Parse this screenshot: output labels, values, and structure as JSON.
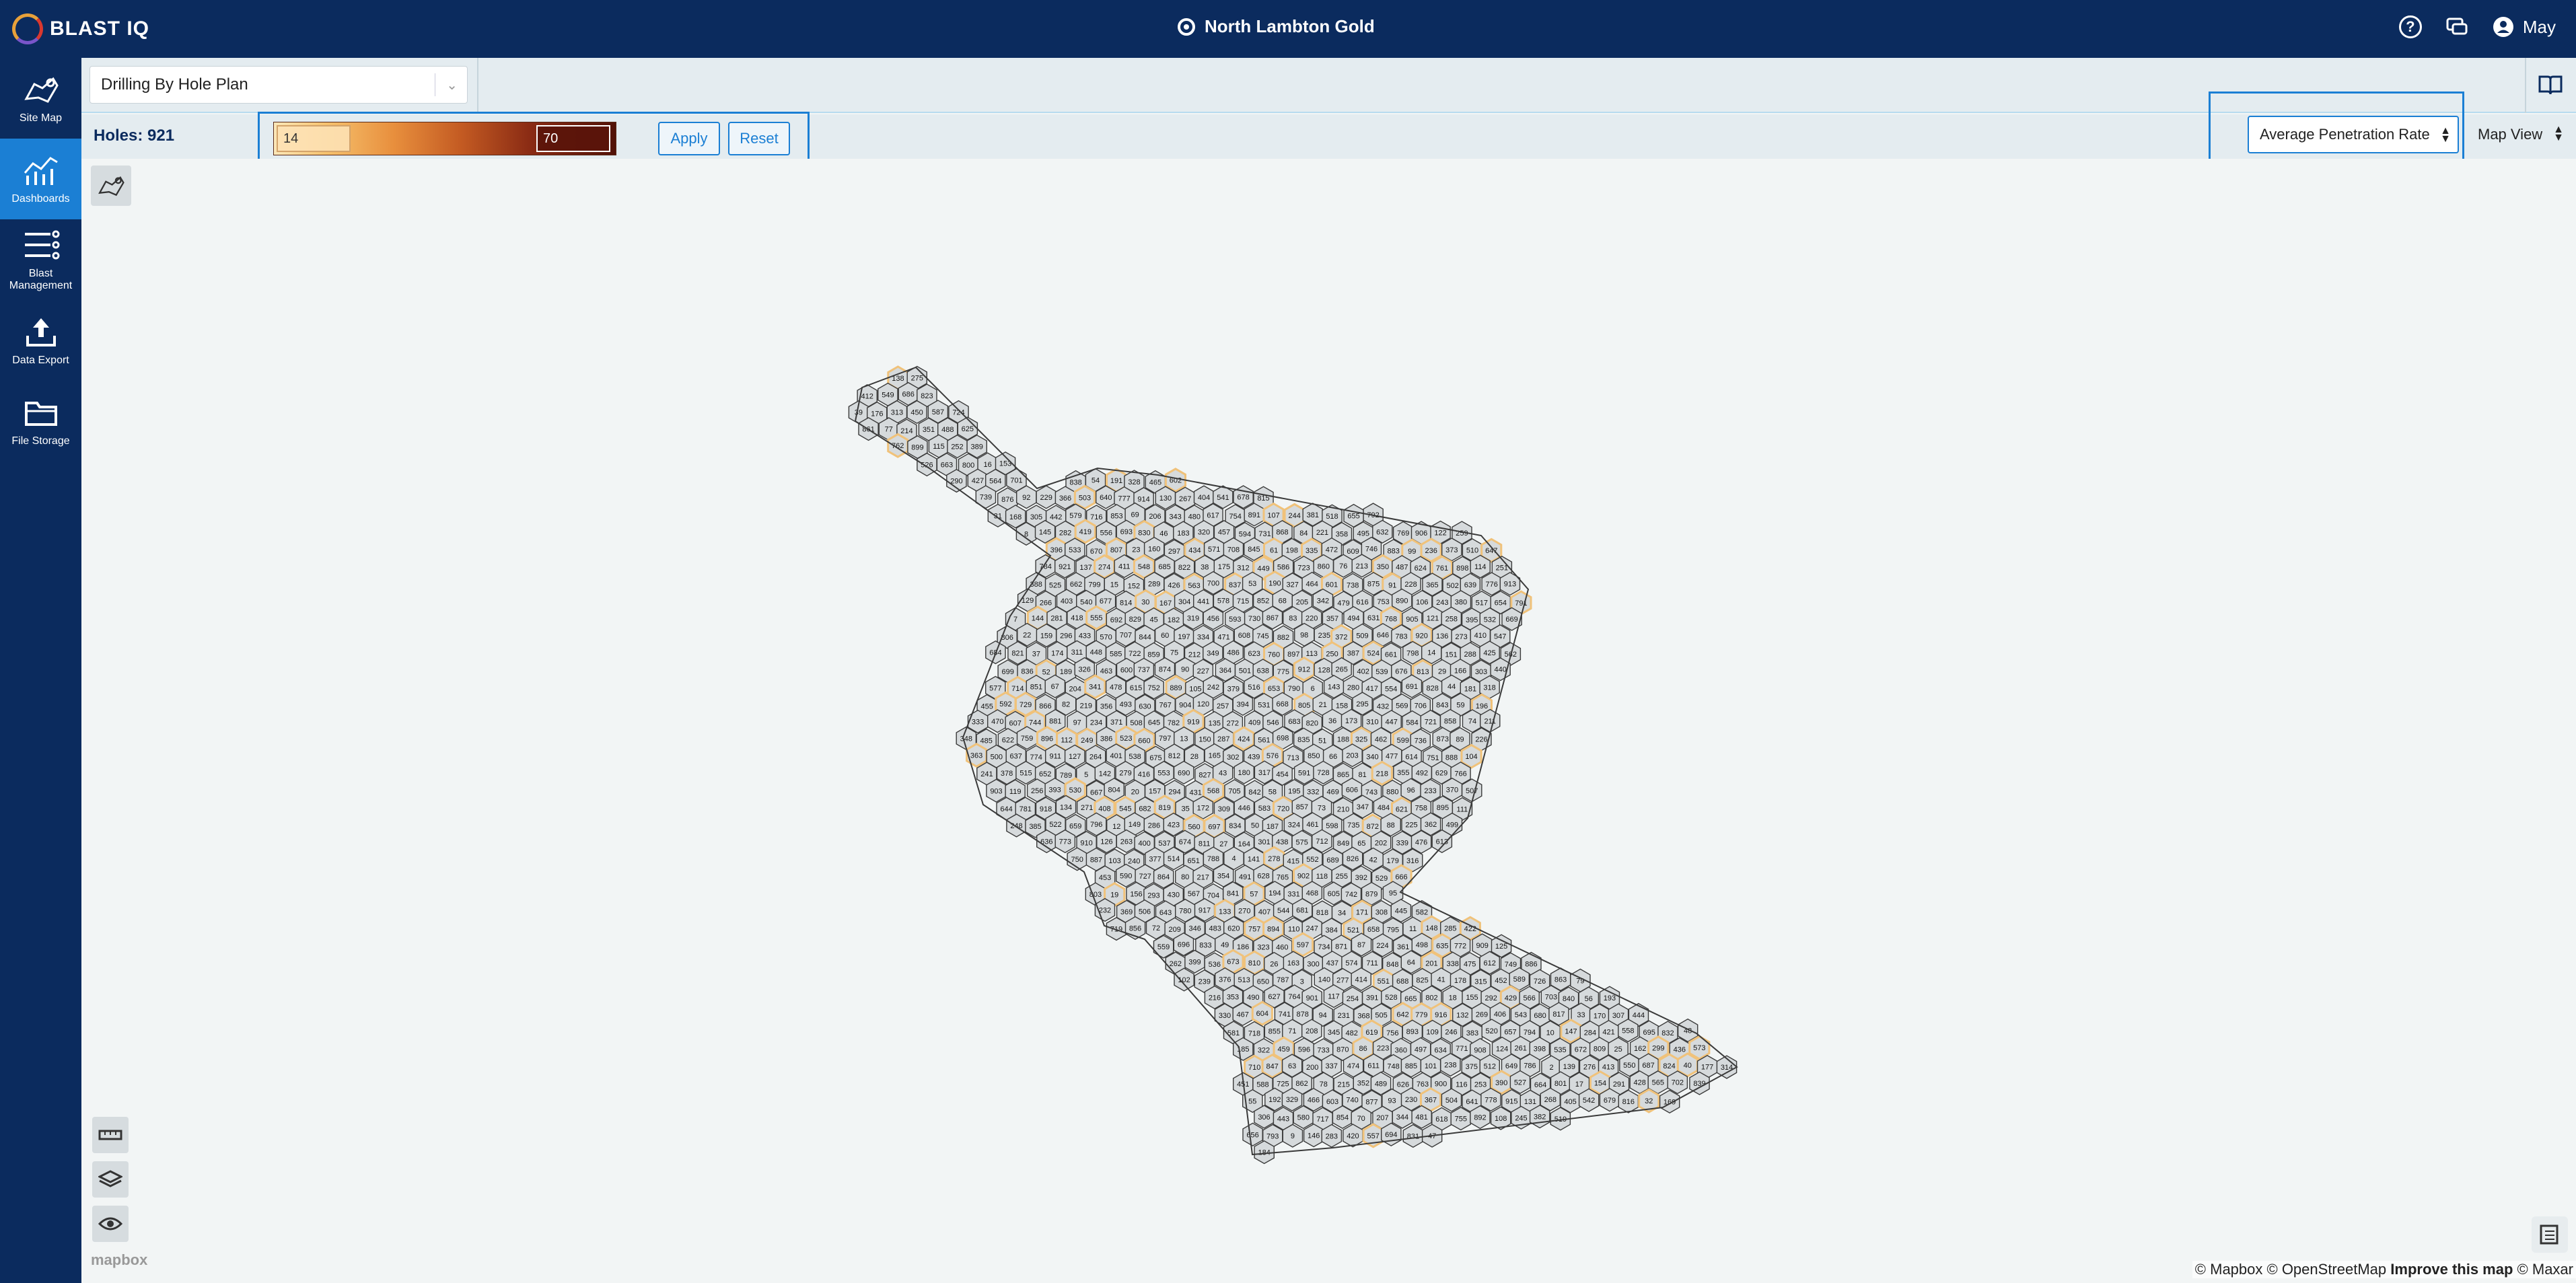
{
  "header": {
    "logo_text": "BLAST IQ",
    "site_name": "North Lambton Gold",
    "user_name": "May",
    "help_icon": "question-circle-icon",
    "chat_icon": "chat-bubble-icon",
    "user_icon": "user-circle-icon"
  },
  "sidebar": {
    "items": [
      {
        "label": "Site Map",
        "icon": "site-map-icon",
        "active": false
      },
      {
        "label": "Dashboards",
        "icon": "dashboard-chart-icon",
        "active": true
      },
      {
        "label": "Blast Management",
        "icon": "blast-management-icon",
        "active": false
      },
      {
        "label": "Data Export",
        "icon": "upload-icon",
        "active": false
      },
      {
        "label": "File Storage",
        "icon": "folder-icon",
        "active": false
      }
    ]
  },
  "toolbar": {
    "plan_select_value": "Drilling By Hole Plan",
    "holes_label": "Holes: 921",
    "range_min": "14",
    "range_max": "70",
    "apply_label": "Apply",
    "reset_label": "Reset",
    "metric_select_value": "Average Penetration Rate",
    "view_select_value": "Map View"
  },
  "map": {
    "attribution_1": "© Mapbox © OpenStreetMap",
    "attribution_improve": "Improve this map",
    "attribution_2": "© Maxar",
    "mapbox_label": "mapbox",
    "hole_count": 921,
    "colors": {
      "cell_fill": "#d6dadc",
      "cell_stroke": "#3a3a3a",
      "highlight": "#f0c27a"
    }
  }
}
